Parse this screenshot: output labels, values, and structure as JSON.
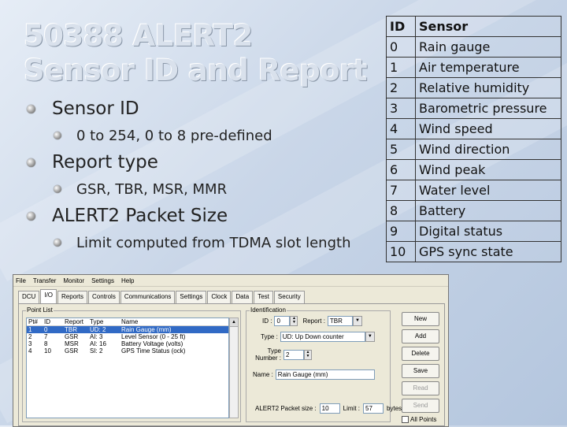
{
  "title": {
    "line1": "50388 ALERT2",
    "line2": "Sensor ID and Report"
  },
  "bullets": [
    {
      "text": "Sensor ID",
      "sub": "0 to 254, 0 to 8 pre-defined"
    },
    {
      "text": "Report type",
      "sub": "GSR, TBR, MSR, MMR"
    },
    {
      "text": "ALERT2 Packet Size",
      "sub": "Limit computed from TDMA slot length"
    }
  ],
  "sensor_table": {
    "headers": [
      "ID",
      "Sensor"
    ],
    "rows": [
      [
        "0",
        "Rain gauge"
      ],
      [
        "1",
        "Air temperature"
      ],
      [
        "2",
        "Relative humidity"
      ],
      [
        "3",
        "Barometric pressure"
      ],
      [
        "4",
        "Wind speed"
      ],
      [
        "5",
        "Wind direction"
      ],
      [
        "6",
        "Wind peak"
      ],
      [
        "7",
        "Water level"
      ],
      [
        "8",
        "Battery"
      ],
      [
        "9",
        "Digital status"
      ],
      [
        "10",
        "GPS sync state"
      ]
    ]
  },
  "app": {
    "menu": [
      "File",
      "Transfer",
      "Monitor",
      "Settings",
      "Help"
    ],
    "tabs": [
      "DCU",
      "I/O",
      "Reports",
      "Controls",
      "Communications",
      "Settings",
      "Clock",
      "Data",
      "Test",
      "Security"
    ],
    "point_list": {
      "label": "Point List",
      "headers": [
        "Pt#",
        "ID",
        "Report",
        "Type",
        "Name"
      ],
      "rows": [
        [
          "1",
          "0",
          "TBR",
          "UD: 2",
          "Rain Gauge (mm)"
        ],
        [
          "2",
          "7",
          "GSR",
          "AI: 3",
          "Level Sensor (0 - 25 ft)"
        ],
        [
          "3",
          "8",
          "MSR",
          "AI: 16",
          "Battery Voltage (volts)"
        ],
        [
          "4",
          "10",
          "GSR",
          "SI: 2",
          "GPS Time Status (ock)"
        ]
      ]
    },
    "identification": {
      "label": "Identification",
      "id_label": "ID :",
      "id_value": "0",
      "report_label": "Report :",
      "report_value": "TBR",
      "type_label": "Type :",
      "type_value": "UD: Up Down counter",
      "type_number_label": "Type Number :",
      "type_number_value": "2",
      "name_label": "Name :",
      "name_value": "Rain Gauge (mm)"
    },
    "packet": {
      "label": "ALERT2 Packet size :",
      "value": "10",
      "limit_label": "Limit :",
      "limit_value": "57",
      "unit": "bytes"
    },
    "buttons": [
      "New",
      "Add",
      "Delete",
      "Save",
      "Read",
      "Send"
    ],
    "all_points_label": "All Points"
  }
}
